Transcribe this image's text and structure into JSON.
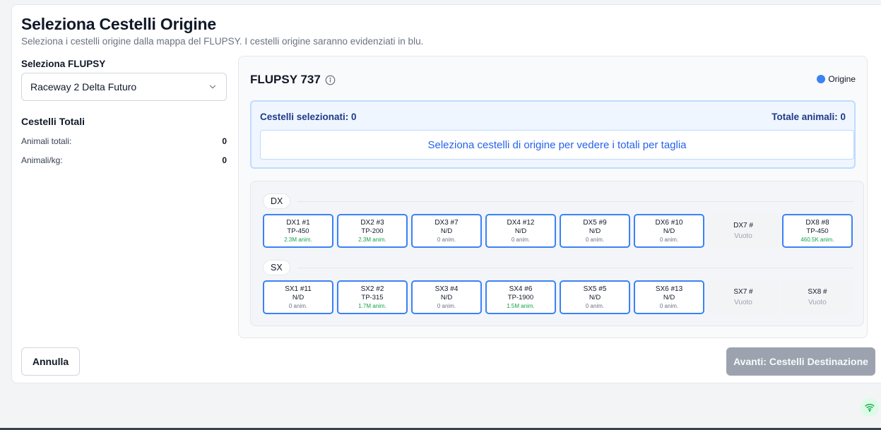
{
  "header": {
    "title": "Seleziona Cestelli Origine",
    "subtitle": "Seleziona i cestelli origine dalla mappa del FLUPSY. I cestelli origine saranno evidenziati in blu."
  },
  "left": {
    "flupsy_label": "Seleziona FLUPSY",
    "flupsy_selected": "Raceway 2 Delta Futuro",
    "totals_title": "Cestelli Totali",
    "animals_total_label": "Animali totali:",
    "animals_total_value": "0",
    "animals_kg_label": "Animali/kg:",
    "animals_kg_value": "0"
  },
  "map": {
    "title": "FLUPSY 737",
    "legend_label": "Origine",
    "legend_color": "#3b82f6",
    "selected_label": "Cestelli selezionati: 0",
    "total_animals_label": "Totale animali: 0",
    "placeholder": "Seleziona cestelli di origine per vedere i totali per taglia",
    "rows": [
      {
        "label": "DX",
        "baskets": [
          {
            "id": "DX1 #1",
            "size": "TP-450",
            "anim": "2.3M anim.",
            "has_animals": true,
            "empty": false
          },
          {
            "id": "DX2 #3",
            "size": "TP-200",
            "anim": "2.3M anim.",
            "has_animals": true,
            "empty": false
          },
          {
            "id": "DX3 #7",
            "size": "N/D",
            "anim": "0 anim.",
            "has_animals": false,
            "empty": false
          },
          {
            "id": "DX4 #12",
            "size": "N/D",
            "anim": "0 anim.",
            "has_animals": false,
            "empty": false
          },
          {
            "id": "DX5 #9",
            "size": "N/D",
            "anim": "0 anim.",
            "has_animals": false,
            "empty": false
          },
          {
            "id": "DX6 #10",
            "size": "N/D",
            "anim": "0 anim.",
            "has_animals": false,
            "empty": false
          },
          {
            "id": "DX7 #",
            "size": "Vuoto",
            "anim": "",
            "has_animals": false,
            "empty": true
          },
          {
            "id": "DX8 #8",
            "size": "TP-450",
            "anim": "460.5K anim.",
            "has_animals": true,
            "empty": false
          }
        ]
      },
      {
        "label": "SX",
        "baskets": [
          {
            "id": "SX1 #11",
            "size": "N/D",
            "anim": "0 anim.",
            "has_animals": false,
            "empty": false
          },
          {
            "id": "SX2 #2",
            "size": "TP-315",
            "anim": "1.7M anim.",
            "has_animals": true,
            "empty": false
          },
          {
            "id": "SX3 #4",
            "size": "N/D",
            "anim": "0 anim.",
            "has_animals": false,
            "empty": false
          },
          {
            "id": "SX4 #6",
            "size": "TP-1900",
            "anim": "1.5M anim.",
            "has_animals": true,
            "empty": false
          },
          {
            "id": "SX5 #5",
            "size": "N/D",
            "anim": "0 anim.",
            "has_animals": false,
            "empty": false
          },
          {
            "id": "SX6 #13",
            "size": "N/D",
            "anim": "0 anim.",
            "has_animals": false,
            "empty": false
          },
          {
            "id": "SX7 #",
            "size": "Vuoto",
            "anim": "",
            "has_animals": false,
            "empty": true
          },
          {
            "id": "SX8 #",
            "size": "Vuoto",
            "anim": "",
            "has_animals": false,
            "empty": true
          }
        ]
      }
    ]
  },
  "actions": {
    "cancel_label": "Annulla",
    "next_label": "Avanti: Cestelli Destinazione"
  }
}
